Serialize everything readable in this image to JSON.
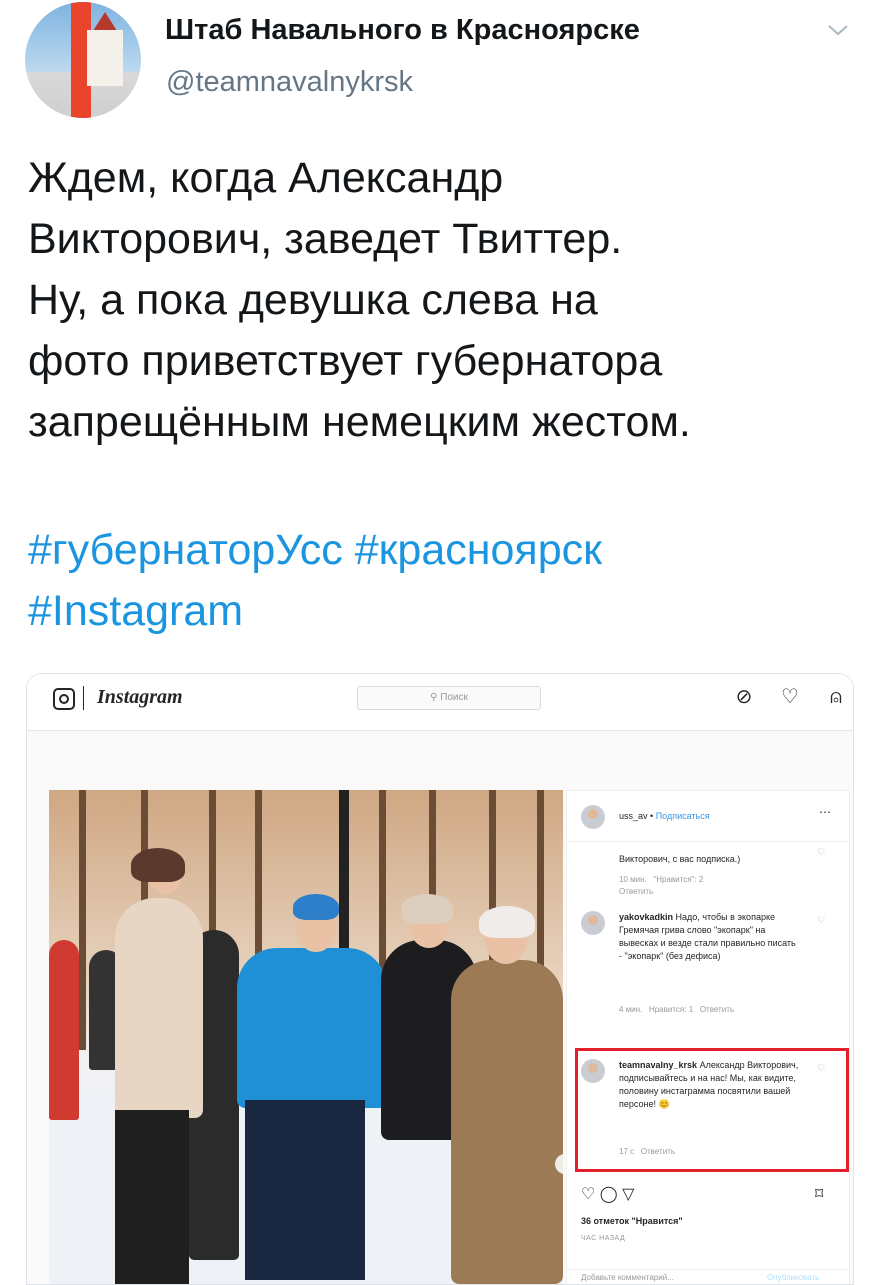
{
  "tweet": {
    "author_name": "Штаб Навального в Красноярске",
    "author_handle": "@teamnavalnykrsk",
    "text_lines": [
      "Ждем, когда Александр",
      "Викторович, заведет Твиттер.",
      "Ну, а пока девушка слева на",
      "фото приветствует губернатора",
      "запрещённым немецким жестом."
    ],
    "hashtag_lines": [
      "#губернаторУсс #красноярск",
      "#Instagram"
    ]
  },
  "instagram": {
    "logo": "Instagram",
    "search_placeholder": "Поиск",
    "post_user": "uss_av",
    "post_follow": "Подписаться",
    "comments": [
      {
        "text": "Викторович, с вас подписка.)",
        "time": "10 мин.",
        "likes": "\"Нравится\": 2",
        "reply": "Ответить"
      },
      {
        "user": "yakovkadkin",
        "text": "Надо, чтобы в экопарке Гремячая грива слово \"экопарк\" на вывесках и везде стали правильно писать - \"экопарк\" (без дефиса)",
        "time": "4 мин.",
        "likes": "Нравится: 1",
        "reply": "Ответить"
      },
      {
        "user": "teamnavalny_krsk",
        "text": "Александр Викторович, подписывайтесь и на нас! Мы, как видите, половину инстаграмма посвятили вашей персоне! 😊",
        "time": "17 с",
        "reply": "Ответить"
      }
    ],
    "likes_count": "36 отметок \"Нравится\"",
    "time_ago": "ЧАС НАЗАД",
    "add_comment": "Добавьте комментарий...",
    "publish": "Опубликовать"
  },
  "colors": {
    "link": "#1b95e0",
    "highlight_box": "#e2202c",
    "ig_link": "#3897f0"
  }
}
